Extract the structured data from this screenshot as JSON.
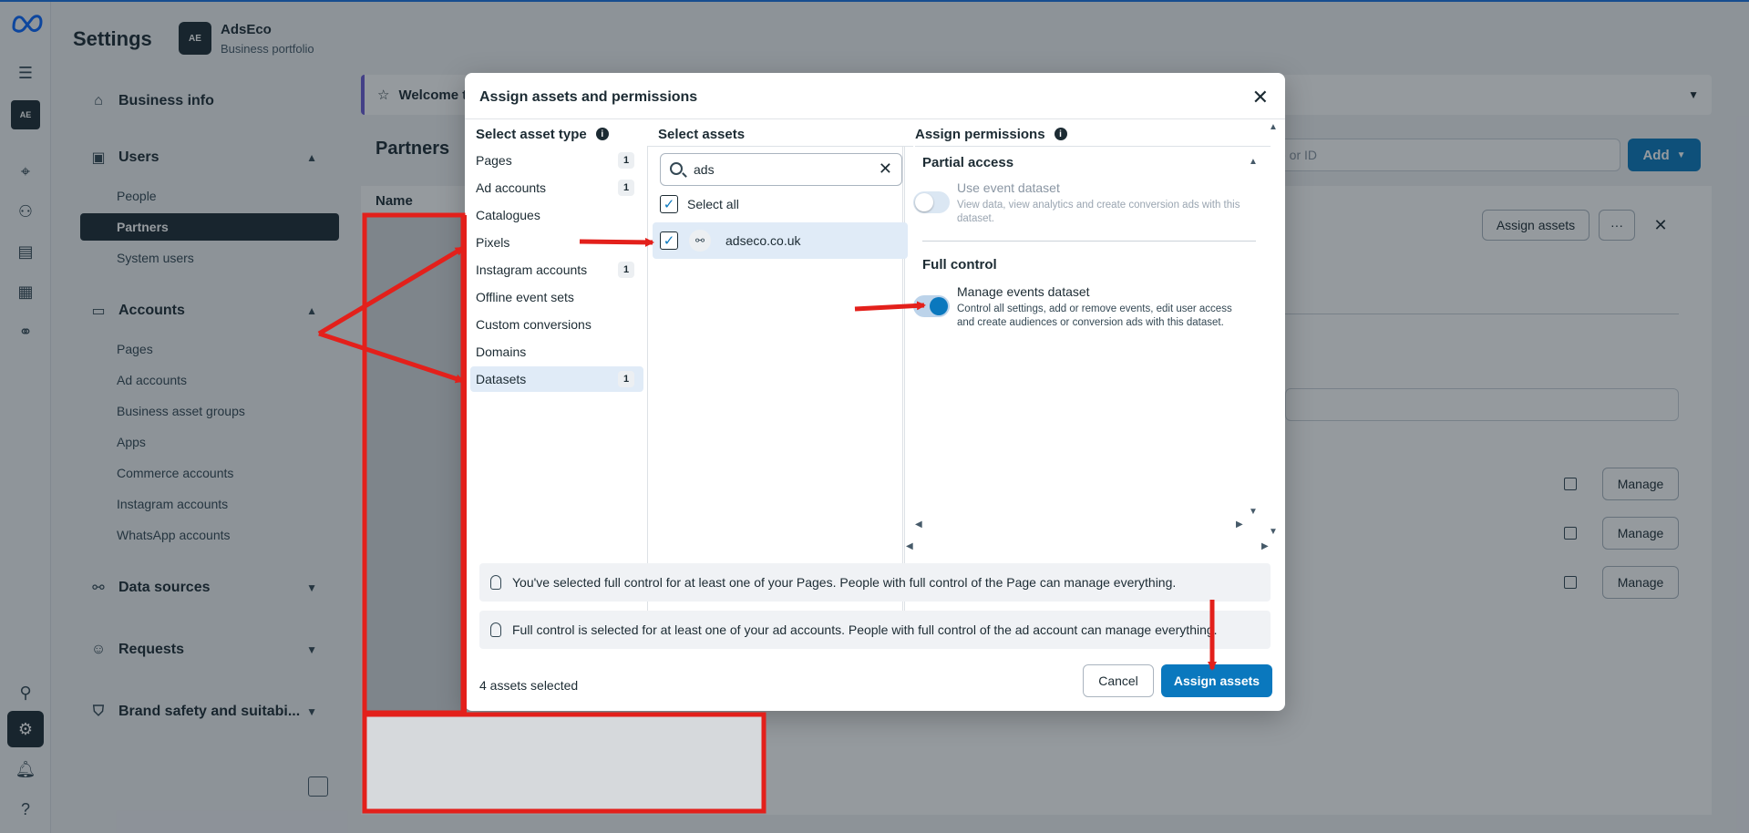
{
  "header": {
    "title": "Settings",
    "portfolio_name": "AdsEco",
    "portfolio_sub": "Business portfolio",
    "portfolio_logo": "AE"
  },
  "sidebar": {
    "business_info": "Business info",
    "users": {
      "label": "Users",
      "items": [
        "People",
        "Partners",
        "System users"
      ]
    },
    "accounts": {
      "label": "Accounts",
      "items": [
        "Pages",
        "Ad accounts",
        "Business asset groups",
        "Apps",
        "Commerce accounts",
        "Instagram accounts",
        "WhatsApp accounts"
      ]
    },
    "data_sources": "Data sources",
    "requests": "Requests",
    "brand_safety": "Brand safety and suitabi..."
  },
  "main": {
    "welcome": "Welcome t",
    "title": "Partners",
    "search_placeholder": "e or ID",
    "add_label": "Add",
    "name_col": "Name",
    "assign_assets_label": "Assign assets",
    "more_label": "···",
    "manage_label": "Manage"
  },
  "modal": {
    "title": "Assign assets and permissions",
    "col_asset_type": "Select asset type",
    "col_assets": "Select assets",
    "col_permissions": "Assign permissions",
    "asset_types": [
      {
        "label": "Pages",
        "count": "1"
      },
      {
        "label": "Ad accounts",
        "count": "1"
      },
      {
        "label": "Catalogues",
        "count": ""
      },
      {
        "label": "Pixels",
        "count": ""
      },
      {
        "label": "Instagram accounts",
        "count": "1"
      },
      {
        "label": "Offline event sets",
        "count": ""
      },
      {
        "label": "Custom conversions",
        "count": ""
      },
      {
        "label": "Domains",
        "count": ""
      },
      {
        "label": "Datasets",
        "count": "1"
      }
    ],
    "search_value": "ads",
    "select_all": "Select all",
    "asset": "adseco.co.uk",
    "partial_access": "Partial access",
    "use_dataset": "Use event dataset",
    "use_dataset_desc": "View data, view analytics and create conversion ads with this dataset.",
    "full_control": "Full control",
    "manage_dataset": "Manage events dataset",
    "manage_dataset_desc": "Control all settings, add or remove events, edit user access and create audiences or conversion ads with this dataset.",
    "notice1": "You've selected full control for at least one of your Pages. People with full control of the Page can manage everything.",
    "notice2": "Full control is selected for at least one of your ad accounts. People with full control of the ad account can manage everything.",
    "selected_count": "4 assets selected",
    "cancel": "Cancel",
    "assign": "Assign assets"
  },
  "colors": {
    "accent": "#0a78be",
    "annotation": "#e3201b",
    "dark": "#1c2b33"
  }
}
